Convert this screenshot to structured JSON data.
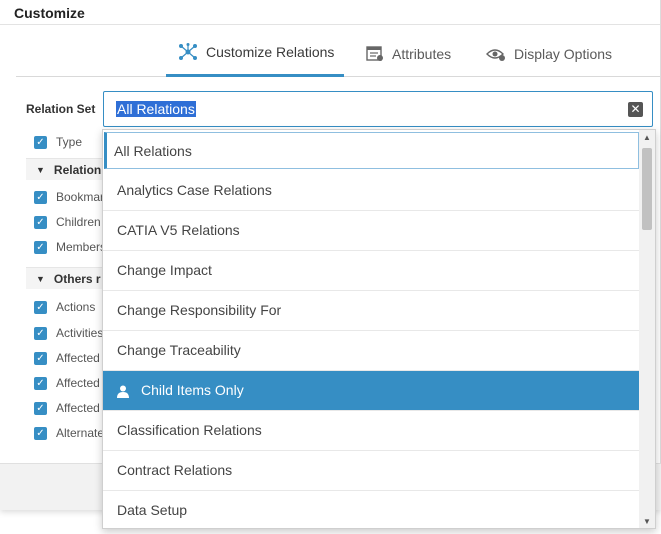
{
  "dialog": {
    "title": "Customize",
    "tabs": [
      {
        "label": "Customize Relations",
        "active": true,
        "icon": "relations-icon"
      },
      {
        "label": "Attributes",
        "active": false,
        "icon": "attributes-icon"
      },
      {
        "label": "Display Options",
        "active": false,
        "icon": "eye-gear-icon"
      }
    ]
  },
  "relation_set": {
    "label": "Relation Set",
    "value": "All Relations"
  },
  "tree": {
    "rows": [
      {
        "type": "item",
        "label": "Type"
      },
      {
        "type": "group",
        "label": "Relation"
      },
      {
        "type": "item",
        "label": "Bookmar"
      },
      {
        "type": "item",
        "label": "Children"
      },
      {
        "type": "item",
        "label": "Members"
      },
      {
        "type": "group",
        "label": "Others r"
      },
      {
        "type": "item",
        "label": "Actions"
      },
      {
        "type": "item",
        "label": "Activities"
      },
      {
        "type": "item",
        "label": "Affected"
      },
      {
        "type": "item",
        "label": "Affected"
      },
      {
        "type": "item",
        "label": "Affected"
      },
      {
        "type": "item",
        "label": "Alternate"
      }
    ]
  },
  "dropdown": {
    "options": [
      "All Relations",
      "Analytics Case Relations",
      "CATIA V5 Relations",
      "Change Impact",
      "Change Responsibility For",
      "Change Traceability",
      "Child Items Only",
      "Classification Relations",
      "Contract Relations",
      "Data Setup"
    ],
    "selected_index": 6
  },
  "colors": {
    "accent": "#368ec4",
    "text_highlight": "#2f6fd6"
  }
}
